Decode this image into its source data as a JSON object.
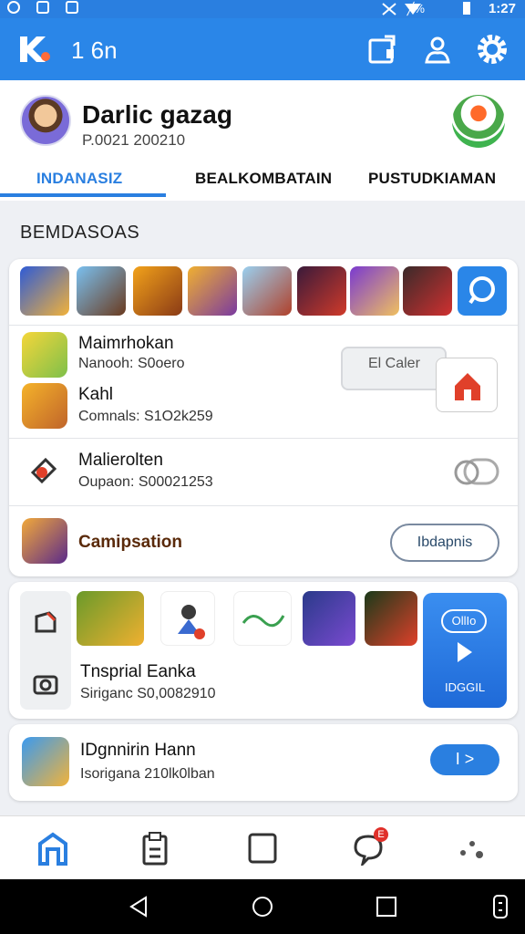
{
  "statusbar": {
    "time": "1:27",
    "battery_text": "╱%"
  },
  "appbar": {
    "title": "1 6n"
  },
  "profile": {
    "name": "Darlic gazag",
    "id": "P.0021 200210"
  },
  "tabs": [
    {
      "label": "INDANASIZ",
      "active": true
    },
    {
      "label": "BEALKOMBATAIN",
      "active": false
    },
    {
      "label": "PUSTUDKIAMAN",
      "active": false
    }
  ],
  "section": {
    "title": "BEMDASOAS"
  },
  "items": {
    "item1": {
      "title": "Maimrhokan",
      "sub": "Nanooh:  S0oero"
    },
    "item2": {
      "title": "Kahl",
      "sub": "Comnals:  S1O2k259"
    },
    "overlay_label": "El Caler",
    "item3": {
      "title": "Malierolten",
      "sub": "Oupaon:  S00021253"
    },
    "item4": {
      "title": "Camipsation",
      "button": "Ibdapnis"
    },
    "item5": {
      "title": "Tnsprial Eanka",
      "sub": "Siriganc  S0,0082910"
    },
    "play_tile": {
      "pill": "OllIo",
      "label": "IDGGIL"
    },
    "item6": {
      "title": "IDgnnirin Hann",
      "sub": "Isorigana  210lk0lban",
      "button": "I >"
    }
  },
  "nav": {
    "notification_badge": "E"
  },
  "colors": {
    "accent": "#2a7fe0",
    "primary_bar": "#2a86e8"
  }
}
